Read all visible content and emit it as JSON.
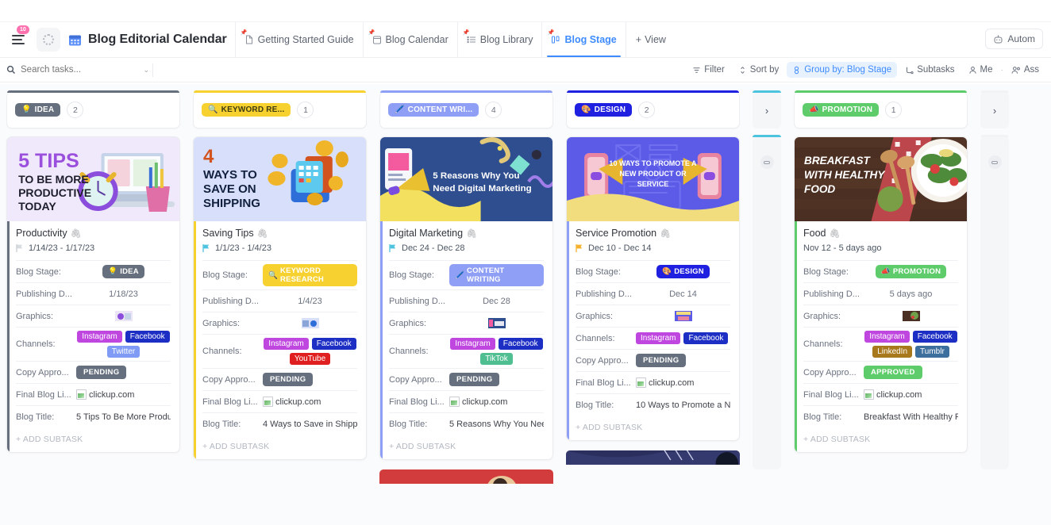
{
  "header": {
    "notification_badge": "10",
    "title": "Blog Editorial Calendar",
    "calendar_icon": "calendar-icon",
    "spinner_icon": "loading-spinner-icon",
    "tabs": [
      {
        "label": "Getting Started Guide",
        "icon": "doc-icon",
        "active": false
      },
      {
        "label": "Blog Calendar",
        "icon": "calendar-view-icon",
        "active": false
      },
      {
        "label": "Blog Library",
        "icon": "list-view-icon",
        "active": false
      },
      {
        "label": "Blog Stage",
        "icon": "board-view-icon",
        "active": true
      }
    ],
    "add_view_label": "View",
    "automations_label": "Autom"
  },
  "toolbar": {
    "search_placeholder": "Search tasks...",
    "filter_label": "Filter",
    "sort_label": "Sort by",
    "group_label": "Group by: Blog Stage",
    "subtasks_label": "Subtasks",
    "me_label": "Me",
    "assignees_label": "Ass"
  },
  "board": {
    "columns": [
      {
        "id": "idea",
        "stage": "IDEA",
        "stage_full": "IDEA",
        "emoji": "💡",
        "chip_color": "#656f7d",
        "bar_color": "#656f7d",
        "count": "2",
        "collapsed": false
      },
      {
        "id": "keyword-research",
        "stage": "KEYWORD RE...",
        "stage_full": "KEYWORD RESEARCH",
        "emoji": "🔍",
        "chip_color": "#f6d130",
        "bar_color": "#f6d130",
        "count": "1",
        "collapsed": false
      },
      {
        "id": "content-writing",
        "stage": "CONTENT WRI...",
        "stage_full": "CONTENT WRITING",
        "emoji": "🖊️",
        "chip_color": "#8f9ff5",
        "bar_color": "#8f9ff5",
        "count": "4",
        "collapsed": false
      },
      {
        "id": "design",
        "stage": "DESIGN",
        "stage_full": "DESIGN",
        "emoji": "🎨",
        "chip_color": "#2020e0",
        "bar_color": "#2020e0",
        "count": "2",
        "collapsed": false
      },
      {
        "id": "collapsed-1",
        "bar_color": "#4ec3e0",
        "collapsed": true
      },
      {
        "id": "promotion",
        "stage": "PROMOTION",
        "stage_full": "PROMOTION",
        "emoji": "📣",
        "chip_color": "#5fcc6b",
        "bar_color": "#5fcc6b",
        "count": "1",
        "collapsed": false
      },
      {
        "id": "collapsed-2",
        "bar_color": "#e9ebef",
        "collapsed": true
      }
    ],
    "field_labels": {
      "blog_stage": "Blog Stage:",
      "publishing_date": "Publishing D...",
      "graphics": "Graphics:",
      "channels": "Channels:",
      "copy_approval": "Copy Appro...",
      "final_blog_link": "Final Blog Li...",
      "blog_title": "Blog Title:"
    },
    "add_subtask_label": "+ ADD SUBTASK",
    "cards": [
      {
        "column": "idea",
        "cover_text": [
          "5 TIPS",
          "TO BE MORE",
          "PRODUCTIVE",
          "TODAY"
        ],
        "cover_bg": "#f0e9fb",
        "title": "Productivity",
        "date_range": "1/14/23  -  1/17/23",
        "flag_color": "#d8dbe0",
        "stage": "IDEA",
        "stage_emoji": "💡",
        "stage_color": "#656f7d",
        "publishing_date": "1/18/23",
        "channels": [
          {
            "name": "Instagram",
            "color": "#bf47e0"
          },
          {
            "name": "Facebook",
            "color": "#1c2ec4"
          },
          {
            "name": "Twitter",
            "color": "#7f9bf5"
          }
        ],
        "copy_approval": "PENDING",
        "copy_approval_color": "#656f7d",
        "final_blog_link": "clickup.com",
        "blog_title": "5 Tips To Be More Produ...",
        "bar_color": "#656f7d"
      },
      {
        "column": "keyword-research",
        "cover_text": [
          "4",
          "WAYS TO",
          "SAVE ON",
          "SHIPPING"
        ],
        "cover_bg": "#d7dffa",
        "title": "Saving Tips",
        "date_range": "1/1/23  -  1/4/23",
        "flag_color": "#4ec3e0",
        "stage": "KEYWORD RESEARCH",
        "stage_emoji": "🔍",
        "stage_color": "#f6d130",
        "publishing_date": "1/4/23",
        "channels": [
          {
            "name": "Instagram",
            "color": "#bf47e0"
          },
          {
            "name": "Facebook",
            "color": "#1c2ec4"
          },
          {
            "name": "YouTube",
            "color": "#e02020"
          }
        ],
        "copy_approval": "PENDING",
        "copy_approval_color": "#656f7d",
        "final_blog_link": "clickup.com",
        "blog_title": "4 Ways to Save in Shippi...",
        "bar_color": "#f6d130"
      },
      {
        "column": "content-writing",
        "cover_text": [
          "5 Reasons Why You",
          "Need Digital Marketing"
        ],
        "cover_bg": "#2f4e8f",
        "title": "Digital Marketing",
        "date_range": "Dec 24  -  Dec 28",
        "flag_color": "#4ec3e0",
        "stage": "CONTENT WRITING",
        "stage_emoji": "🖊️",
        "stage_color": "#8f9ff5",
        "publishing_date": "Dec 28",
        "channels": [
          {
            "name": "Instagram",
            "color": "#bf47e0"
          },
          {
            "name": "Facebook",
            "color": "#1c2ec4"
          },
          {
            "name": "TikTok",
            "color": "#4fbf92"
          }
        ],
        "copy_approval": "PENDING",
        "copy_approval_color": "#656f7d",
        "final_blog_link": "clickup.com",
        "blog_title": "5 Reasons Why You Nee...",
        "bar_color": "#8f9ff5"
      },
      {
        "column": "design",
        "cover_text": [
          "10 WAYS TO PROMOTE A",
          "NEW PRODUCT OR",
          "SERVICE"
        ],
        "cover_bg": "#5b5be8",
        "title": "Service Promotion",
        "date_range": "Dec 10  -  Dec 14",
        "flag_color": "#f5b12b",
        "stage": "DESIGN",
        "stage_emoji": "🎨",
        "stage_color": "#2020e0",
        "publishing_date": "Dec 14",
        "channels": [
          {
            "name": "Instagram",
            "color": "#bf47e0"
          },
          {
            "name": "Facebook",
            "color": "#1c2ec4"
          }
        ],
        "copy_approval": "PENDING",
        "copy_approval_color": "#656f7d",
        "final_blog_link": "clickup.com",
        "blog_title": "10 Ways to Promote a N...",
        "bar_color": "#8f9ff5"
      },
      {
        "column": "promotion",
        "cover_text": [
          "BREAKFAST",
          "WITH HEALTHY",
          "FOOD"
        ],
        "cover_bg": "#4b2f22",
        "title": "Food",
        "date_range": "Nov 12  -  5 days ago",
        "flag_color": "#ffffff",
        "stage": "PROMOTION",
        "stage_emoji": "📣",
        "stage_color": "#5fcc6b",
        "publishing_date": "5 days ago",
        "channels": [
          {
            "name": "Instagram",
            "color": "#bf47e0"
          },
          {
            "name": "Facebook",
            "color": "#1c2ec4"
          },
          {
            "name": "LinkedIn",
            "color": "#a8781c"
          },
          {
            "name": "Tumblr",
            "color": "#3c6e9e"
          }
        ],
        "copy_approval": "APPROVED",
        "copy_approval_color": "#5fcc6b",
        "final_blog_link": "clickup.com",
        "blog_title": "Breakfast With Healthy F...",
        "bar_color": "#5fcc6b"
      }
    ],
    "partial_cards": [
      {
        "column": "content-writing",
        "cover_bg": "#d23c3c"
      },
      {
        "column": "design",
        "cover_bg": "#2a2f5e"
      }
    ]
  }
}
